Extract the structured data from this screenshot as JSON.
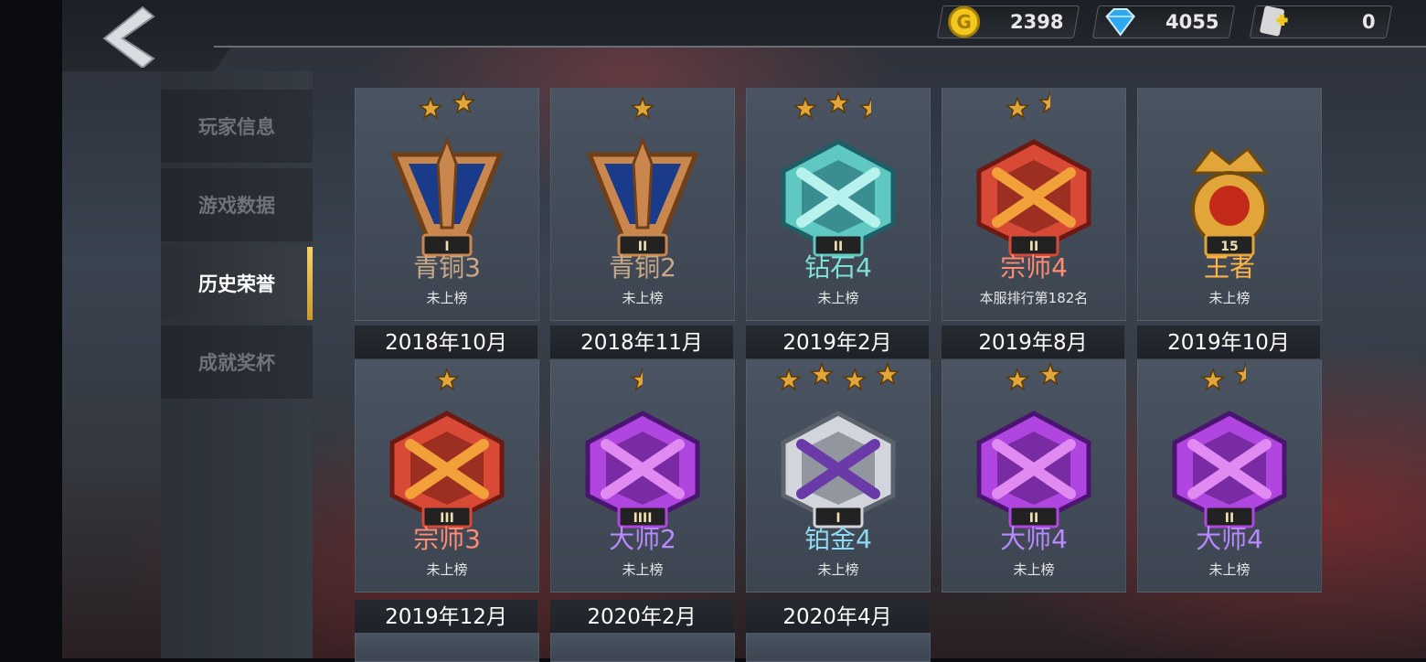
{
  "currencies": {
    "coins": "2398",
    "diamonds": "4055",
    "tickets": "0"
  },
  "sidebar": {
    "items": [
      {
        "label": "玩家信息",
        "active": false
      },
      {
        "label": "游戏数据",
        "active": false
      },
      {
        "label": "历史荣誉",
        "active": true
      },
      {
        "label": "成就奖杯",
        "active": false
      }
    ]
  },
  "seasons": [
    {
      "date": "",
      "title": "青铜3",
      "ranking": "未上榜",
      "stars": 2,
      "tier": "bronze",
      "numeral": "I",
      "color": "#c9a88a"
    },
    {
      "date": "",
      "title": "青铜2",
      "ranking": "未上榜",
      "stars": 1,
      "tier": "bronze",
      "numeral": "II",
      "color": "#c9a88a"
    },
    {
      "date": "",
      "title": "钻石4",
      "ranking": "未上榜",
      "stars": 2.5,
      "tier": "diamond",
      "numeral": "II",
      "color": "#7fe0d8"
    },
    {
      "date": "",
      "title": "宗师4",
      "ranking": "本服排行第182名",
      "stars": 1.5,
      "tier": "grandmaster",
      "numeral": "II",
      "color": "#ff8c72"
    },
    {
      "date": "",
      "title": "王者",
      "ranking": "未上榜",
      "stars": 0,
      "tier": "king",
      "numeral": "15",
      "color": "#ffb347"
    },
    {
      "date": "2018年10月",
      "title": "宗师3",
      "ranking": "未上榜",
      "stars": 1,
      "tier": "grandmaster",
      "numeral": "III",
      "color": "#ff8c72"
    },
    {
      "date": "2018年11月",
      "title": "大师2",
      "ranking": "未上榜",
      "stars": 0.5,
      "tier": "master",
      "numeral": "IIII",
      "color": "#b98aff"
    },
    {
      "date": "2019年2月",
      "title": "铂金4",
      "ranking": "未上榜",
      "stars": 4,
      "tier": "platinum",
      "numeral": "I",
      "color": "#8fd8f2"
    },
    {
      "date": "2019年8月",
      "title": "大师4",
      "ranking": "未上榜",
      "stars": 2,
      "tier": "master",
      "numeral": "II",
      "color": "#b98aff"
    },
    {
      "date": "2019年10月",
      "title": "大师4",
      "ranking": "未上榜",
      "stars": 1.5,
      "tier": "master",
      "numeral": "II",
      "color": "#b98aff"
    }
  ],
  "partial_dates": [
    "2019年12月",
    "2020年2月",
    "2020年4月"
  ]
}
